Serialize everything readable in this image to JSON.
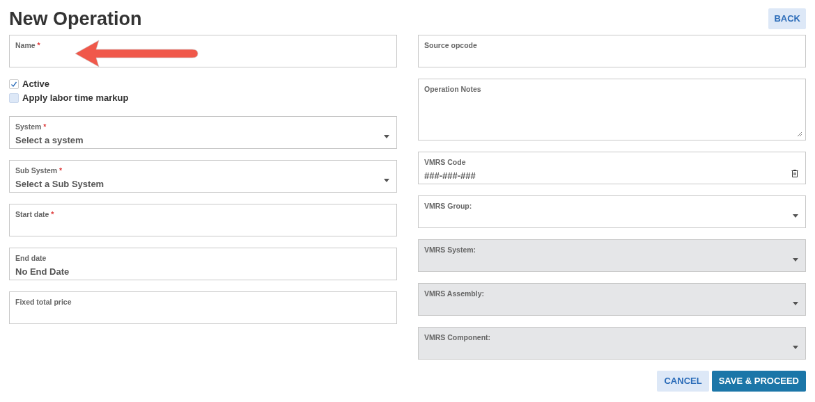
{
  "title": "New Operation",
  "back_button": "BACK",
  "annotation": {
    "kind": "arrow",
    "color": "#f0584a"
  },
  "left_fields": [
    {
      "kind": "text",
      "label": "Name",
      "required_mark": "*"
    },
    {
      "kind": "checkbox",
      "label": "Active",
      "checked": true
    },
    {
      "kind": "checkbox",
      "label": "Apply labor time markup",
      "checked": false
    },
    {
      "kind": "select",
      "label": "System",
      "required_mark": "*",
      "value": "Select a system"
    },
    {
      "kind": "select",
      "label": "Sub System",
      "required_mark": "*",
      "value": "Select a Sub System"
    },
    {
      "kind": "text",
      "label": "Start date",
      "required_mark": "*"
    },
    {
      "kind": "text",
      "label": "End date",
      "value": "No End Date"
    },
    {
      "kind": "text",
      "label": "Fixed total price"
    }
  ],
  "right_fields": [
    {
      "kind": "text",
      "label": "Source opcode"
    },
    {
      "kind": "textarea",
      "label": "Operation Notes"
    },
    {
      "kind": "code",
      "label": "VMRS Code",
      "value": "###-###-###"
    },
    {
      "kind": "select",
      "label": "VMRS Group:",
      "disabled": false
    },
    {
      "kind": "select",
      "label": "VMRS System:",
      "disabled": true
    },
    {
      "kind": "select",
      "label": "VMRS Assembly:",
      "disabled": true
    },
    {
      "kind": "select",
      "label": "VMRS Component:",
      "disabled": true
    }
  ],
  "actions": [
    {
      "label": "CANCEL",
      "kind": "secondary"
    },
    {
      "label": "SAVE & PROCEED",
      "kind": "primary"
    }
  ]
}
